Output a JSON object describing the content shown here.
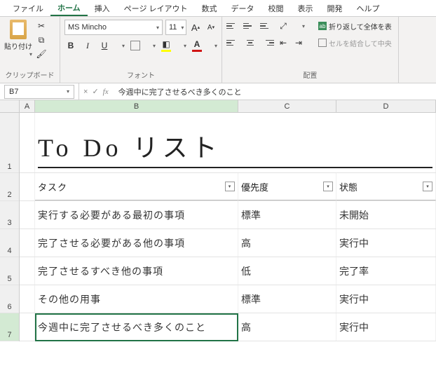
{
  "menu": {
    "items": [
      "ファイル",
      "ホーム",
      "挿入",
      "ページ レイアウト",
      "数式",
      "データ",
      "校閲",
      "表示",
      "開発",
      "ヘルプ"
    ],
    "active_index": 1
  },
  "ribbon": {
    "clipboard": {
      "paste": "貼り付け",
      "group_label": "クリップボード"
    },
    "font": {
      "name": "MS Mincho",
      "size": "11",
      "bold": "B",
      "italic": "I",
      "underline": "U",
      "grow": "A",
      "shrink": "A",
      "group_label": "フォント"
    },
    "align": {
      "wrap": "折り返して全体を表",
      "merge": "セルを結合して中央",
      "group_label": "配置"
    }
  },
  "formula_bar": {
    "name_box": "B7",
    "cancel": "×",
    "confirm": "✓",
    "fx": "fx",
    "formula": "今週中に完了させるべき多くのこと"
  },
  "columns": [
    "A",
    "B",
    "C",
    "D"
  ],
  "rows": [
    "1",
    "2",
    "3",
    "4",
    "5",
    "6",
    "7"
  ],
  "sheet": {
    "title": "To Do リスト",
    "headers": {
      "task": "タスク",
      "priority": "優先度",
      "status": "状態"
    },
    "data": [
      {
        "task": "実行する必要がある最初の事項",
        "priority": "標準",
        "status": "未開始"
      },
      {
        "task": "完了させる必要がある他の事項",
        "priority": "高",
        "status": "実行中"
      },
      {
        "task": "完了させるすべき他の事項",
        "priority": "低",
        "status": "完了率"
      },
      {
        "task": "その他の用事",
        "priority": "標準",
        "status": "実行中"
      },
      {
        "task": "今週中に完了させるべき多くのこと",
        "priority": "高",
        "status": "実行中"
      }
    ]
  },
  "selection": {
    "cell": "B7"
  }
}
